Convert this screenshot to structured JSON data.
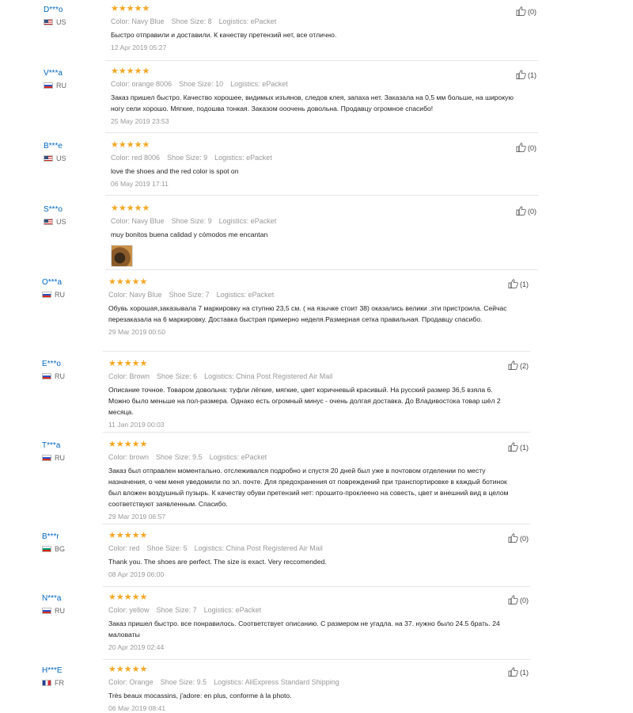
{
  "labels": {
    "color": "Color:",
    "shoe_size": "Shoe Size:",
    "logistics": "Logistics:"
  },
  "reviews": [
    {
      "user": "D***o",
      "country": "US",
      "flag": "us",
      "stars": "★★★★★",
      "color": "Navy Blue",
      "size": "8",
      "logistics": "ePacket",
      "text": "Быстро отправили и доставили. К качеству претензий нет, все отлично.",
      "date": "12 Apr 2019 05:27",
      "helpful": "(0)"
    },
    {
      "user": "V***a",
      "country": "RU",
      "flag": "ru",
      "stars": "★★★★★",
      "color": "orange 8006",
      "size": "10",
      "logistics": "ePacket",
      "text": "Заказ пришел быстро. Качество хорошее, видимых изъянов, следов клея, запаха нет. Заказала на 0,5 мм больше, на широкую ногу сели хорошо. Мягкие, подошва тонкая. Заказом ооочень довольна. Продавцу огромное спасибо!",
      "date": "25 May 2019 23:53",
      "helpful": "(1)"
    },
    {
      "user": "B***e",
      "country": "US",
      "flag": "us",
      "stars": "★★★★★",
      "color": "red 8006",
      "size": "9",
      "logistics": "ePacket",
      "text": "love the shoes and the red color is spot on",
      "date": "06 May 2019 17:11",
      "helpful": "(0)"
    },
    {
      "user": "S***o",
      "country": "US",
      "flag": "us",
      "stars": "★★★★★",
      "color": "Navy Blue",
      "size": "9",
      "logistics": "ePacket",
      "text": "muy bonitos buena calidad y cómodos me encantan",
      "date": "",
      "helpful": "(0)"
    },
    {
      "user": "O***a",
      "country": "RU",
      "flag": "ru",
      "stars": "★★★★★",
      "color": "Navy Blue",
      "size": "7",
      "logistics": "ePacket",
      "text": "Обувь хорошая,заказывала 7 маркировку на ступню 23,5 см. ( на язычке стоит 38) оказались велики .эти пристроила. Сейчас перезаказала на 6 маркировку. Доставка быстрая примерно неделя.Размерная сетка правильная. Продавцу спасибо.",
      "date": "29 Mar 2019 00:50",
      "helpful": "(1)"
    },
    {
      "user": "E***o",
      "country": "RU",
      "flag": "ru",
      "stars": "★★★★★",
      "color": "Brown",
      "size": "6",
      "logistics": "China Post Registered Air Mail",
      "text": "Описание точное. Товаром довольна: туфли лёгкие, мягкие, цвет коричневый красивый. На русский размер 36,5 взяла 6. Можно было меньше на пол-размера. Однако есть огромный минус - очень долгая доставка. До Владивостока товар шёл 2 месяца.",
      "date": "11 Jan 2019 00:03",
      "helpful": "(2)"
    },
    {
      "user": "T***a",
      "country": "RU",
      "flag": "ru",
      "stars": "★★★★★",
      "color": "brown",
      "size": "9.5",
      "logistics": "ePacket",
      "text": "Заказ был отправлен моментально. отслеживался подробно и спустя 20 дней был уже в почтовом отделении по месту назначения, о чем меня уведомили по эл. почте. Для предохранения от повреждений при транспортировке в каждый ботинок был вложен воздушный пузырь. К качеству обуви претензий нет: прошито-проклеено на совесть, цвет и внешний вид в целом соответствуют заявленным. Спасибо.",
      "date": "29 Mar 2019 06:57",
      "helpful": "(1)"
    },
    {
      "user": "B***r",
      "country": "BG",
      "flag": "bg",
      "stars": "★★★★★",
      "color": "red",
      "size": "5",
      "logistics": "China Post Registered Air Mail",
      "text": "Thank you. The shoes are perfect. The size is exact. Very reccomended.",
      "date": "08 Apr 2019 06:00",
      "helpful": "(0)"
    },
    {
      "user": "N***a",
      "country": "RU",
      "flag": "ru",
      "stars": "★★★★★",
      "color": "yellow",
      "size": "7",
      "logistics": "ePacket",
      "text": "Заказ пришел быстро. все понравилось. Соответствует описанию. С размером не угадла. на 37. нужно было 24.5 брать. 24 маловаты",
      "date": "20 Apr 2019 02:44",
      "helpful": "(0)"
    },
    {
      "user": "H***E",
      "country": "FR",
      "flag": "fr",
      "stars": "★★★★★",
      "color": "Orange",
      "size": "9.5",
      "logistics": "AliExpress Standard Shipping",
      "text": "Très beaux mocassins, j'adore: en plus, conforme à la photo.",
      "date": "06 Mar 2019 08:41",
      "helpful": "(1)"
    }
  ]
}
